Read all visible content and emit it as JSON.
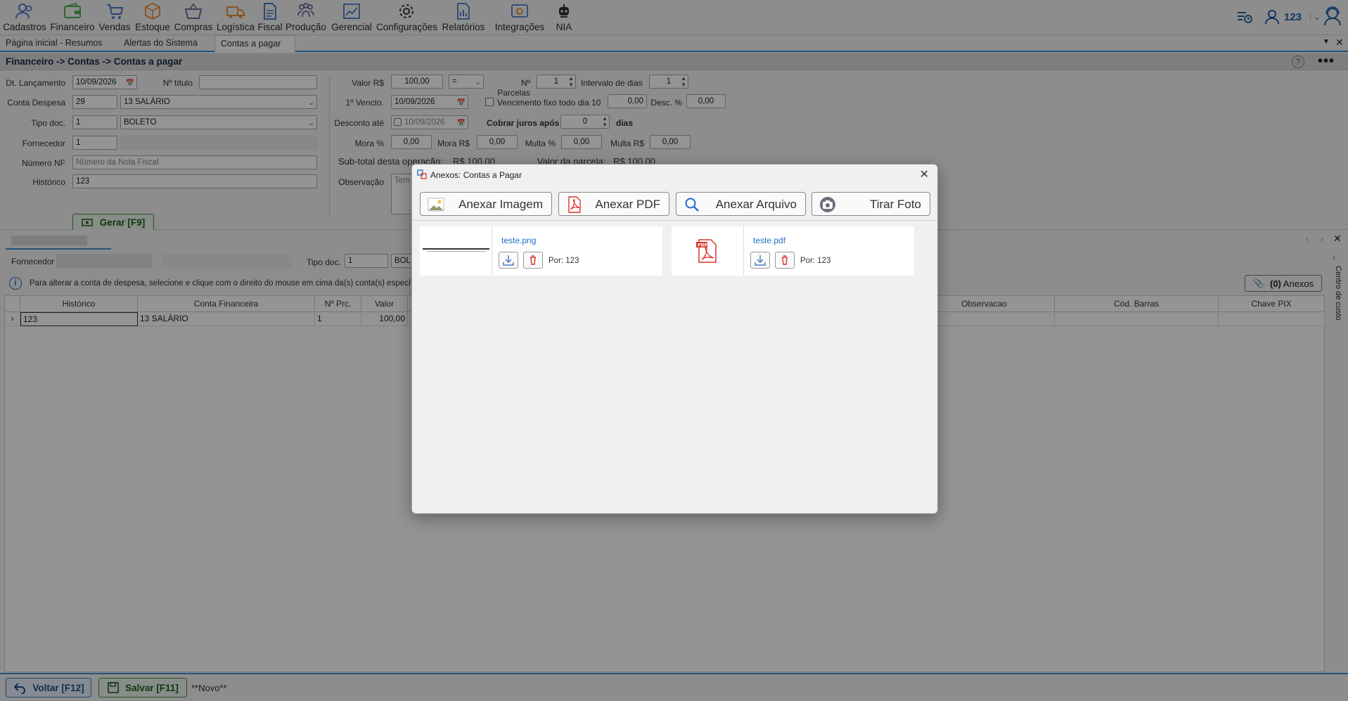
{
  "menu": [
    {
      "label": "Cadastros",
      "icon": "users-icon",
      "color": "#4a7bc8"
    },
    {
      "label": "Financeiro",
      "icon": "wallet-icon",
      "color": "#4caf50"
    },
    {
      "label": "Vendas",
      "icon": "cart-icon",
      "color": "#4a7bc8"
    },
    {
      "label": "Estoque",
      "icon": "box-icon",
      "color": "#e8933a"
    },
    {
      "label": "Compras",
      "icon": "basket-icon",
      "color": "#6b6b9e"
    },
    {
      "label": "Logística",
      "icon": "truck-icon",
      "color": "#e8933a"
    },
    {
      "label": "Fiscal",
      "icon": "document-icon",
      "color": "#4a7bc8"
    },
    {
      "label": "Produção",
      "icon": "team-icon",
      "color": "#6b6b9e"
    },
    {
      "label": "Gerencial",
      "icon": "chart-icon",
      "color": "#4a7bc8"
    },
    {
      "label": "Configurações",
      "icon": "gear-icon",
      "color": "#333333"
    },
    {
      "label": "Relatórios",
      "icon": "report-icon",
      "color": "#4a7bc8"
    },
    {
      "label": "Integrações",
      "icon": "integration-icon",
      "color": "#e8933a"
    },
    {
      "label": "NIA",
      "icon": "robot-icon",
      "color": "#333333"
    }
  ],
  "user": {
    "name": "123"
  },
  "tabs": [
    {
      "label": "Página inicial - Resumos"
    },
    {
      "label": "Alertas do Sistema"
    },
    {
      "label": "Contas a pagar"
    }
  ],
  "breadcrumb": "Financeiro -> Contas -> Contas a pagar",
  "form": {
    "dt_lancamento_label": "Dt. Lançamento",
    "dt_lancamento": "10/09/2026",
    "n_titulo_label": "Nº título",
    "n_titulo": "",
    "conta_despesa_label": "Conta Despesa",
    "conta_despesa_code": "29",
    "conta_despesa_name": "13 SALÁRIO",
    "tipo_doc_label": "Tipo doc.",
    "tipo_doc_code": "1",
    "tipo_doc_name": "BOLETO",
    "fornecedor_label": "Fornecedor",
    "fornecedor_code": "1",
    "numero_nf_label": "Número NF",
    "numero_nf_placeholder": "Número da Nota Fiscal",
    "historico_label": "Histórico",
    "historico": "123",
    "valor_label": "Valor R$",
    "valor": "100,00",
    "operador": "=",
    "n_parcelas_label": "Nº Parcelas",
    "n_parcelas": "1",
    "intervalo_label": "Intervalo de dias",
    "intervalo": "1",
    "primeiro_vencto_label": "1º Vencto.",
    "primeiro_vencto": "10/09/2026",
    "vencimento_fixo_label": "Vencimento fixo todo dia 10",
    "vencimento_fixo_val": "0,00",
    "desc_pct_label": "Desc. %",
    "desc_pct": "0,00",
    "desconto_ate_label": "Desconto até",
    "desconto_ate": "10/09/2026",
    "cobrar_juros_label": "Cobrar juros após",
    "cobrar_juros": "0",
    "dias_label": "dias",
    "mora_pct_label": "Mora %",
    "mora_pct": "0,00",
    "mora_rs_label": "Mora R$",
    "mora_rs": "0,00",
    "multa_pct_label": "Multa %",
    "multa_pct": "0,00",
    "multa_rs_label": "Multa R$",
    "multa_rs": "0,00",
    "subtotal_label": "Sub-total desta operação:",
    "subtotal": "R$ 100,00",
    "valor_parcela_label": "Valor da parcela:",
    "valor_parcela": "R$ 100,00",
    "observacao_label": "Observação",
    "observacao_placeholder": "Tem",
    "gerar_label": "Gerar [F9]"
  },
  "lower": {
    "fornecedor_label": "Fornecedor",
    "tipo_doc_label": "Tipo doc.",
    "tipo_doc_code": "1",
    "tipo_doc_name": "BOLE",
    "info_text": "Para alterar a conta de despesa, selecione e clique com o direito do mouse em cima da(s) conta(s) específica",
    "anexos_count": "(0)",
    "anexos_label": "Anexos",
    "side_label": "Centro de custo",
    "columns": [
      "Histórico",
      "Conta Financeira",
      "Nº Prc.",
      "Valor",
      "Observacao",
      "Cód. Barras",
      "Chave PIX"
    ],
    "rows": [
      {
        "historico": "123",
        "conta": "13 SALÁRIO",
        "parcela": "1",
        "valor": "100,00"
      }
    ]
  },
  "footer": {
    "voltar_label": "Voltar [F12]",
    "salvar_label": "Salvar [F11]",
    "status": "**Novo**"
  },
  "modal": {
    "title": "Anexos: Contas a Pagar",
    "buttons": [
      {
        "label": "Anexar Imagem",
        "icon": "image-icon"
      },
      {
        "label": "Anexar PDF",
        "icon": "pdf-icon"
      },
      {
        "label": "Anexar Arquivo",
        "icon": "search-icon"
      },
      {
        "label": "Tirar Foto",
        "icon": "camera-icon"
      }
    ],
    "files": [
      {
        "name": "teste.png",
        "by": "Por: 123",
        "type": "image"
      },
      {
        "name": "teste.pdf",
        "by": "Por: 123",
        "type": "pdf"
      }
    ]
  },
  "colors": {
    "accent": "#3d8fd1",
    "green": "#4c8a4c",
    "pdf_red": "#d9342b"
  }
}
